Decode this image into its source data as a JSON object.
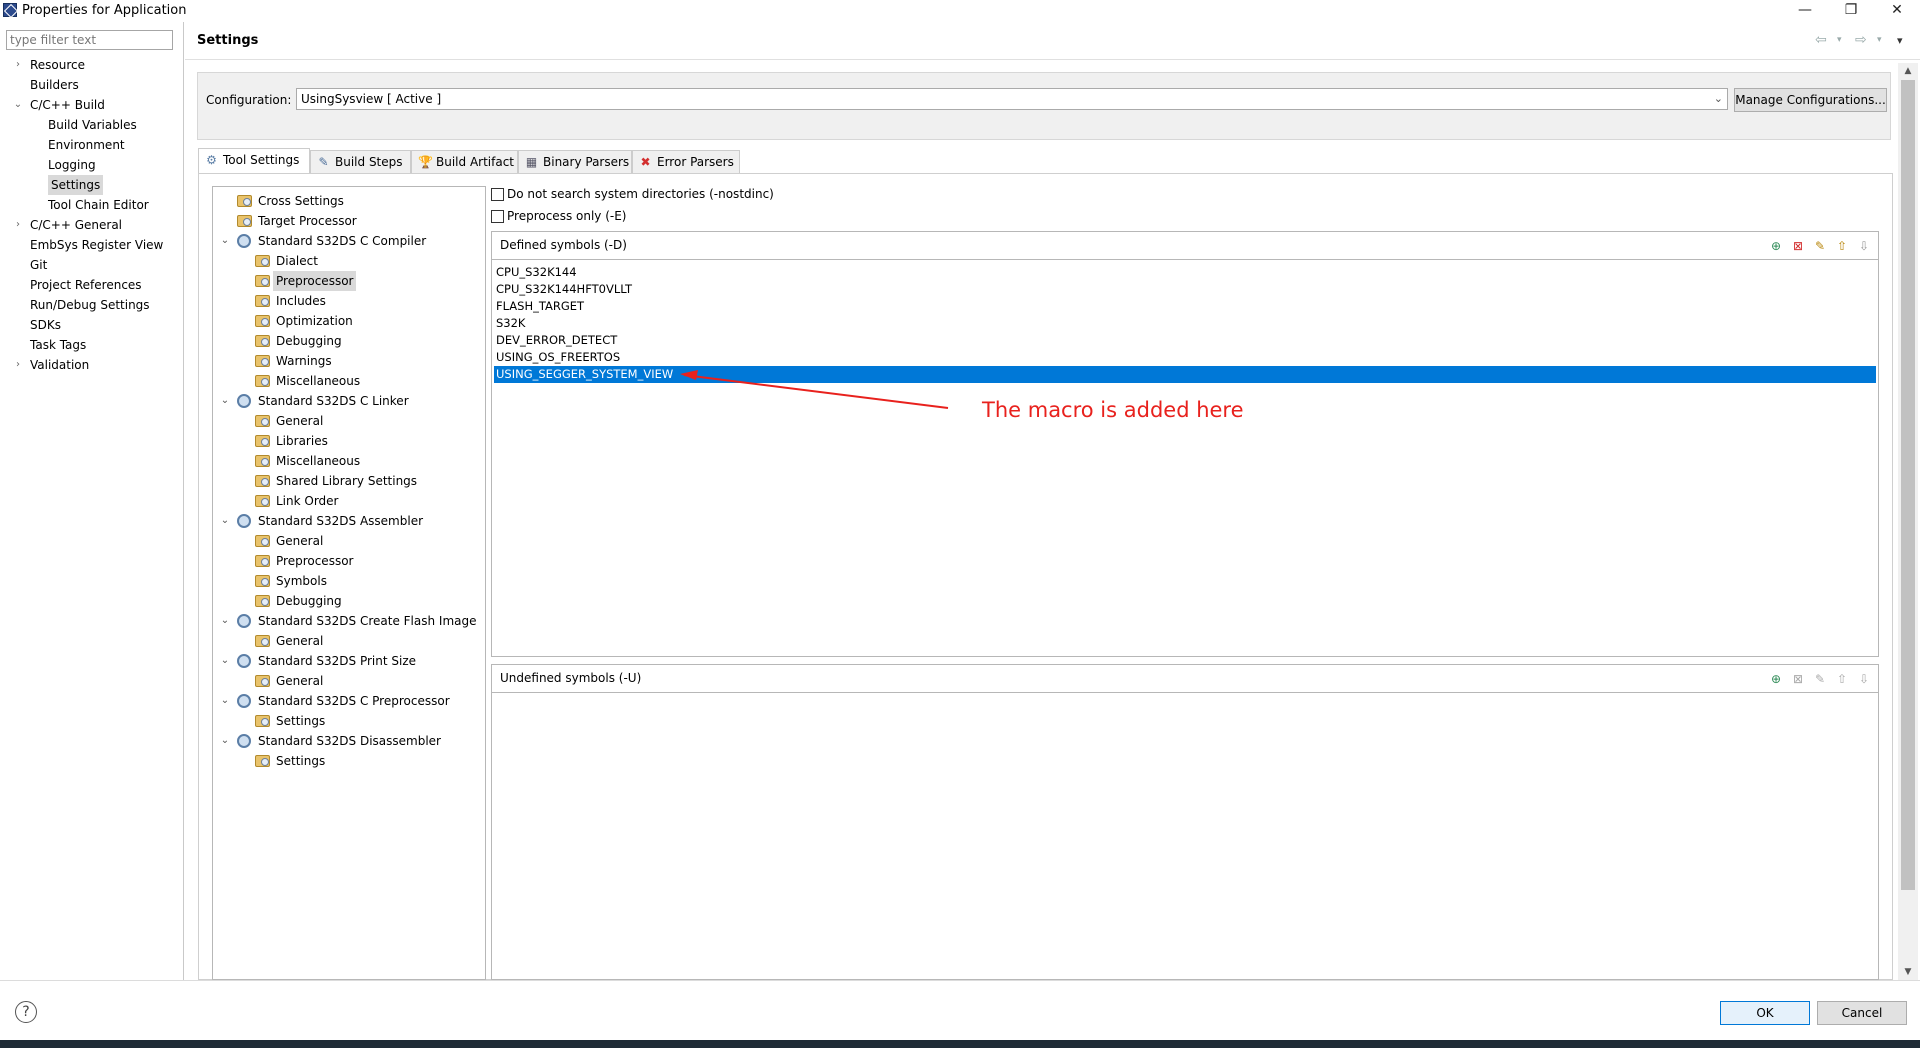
{
  "window": {
    "title": "Properties for Application",
    "minimize": "—",
    "restore": "❐",
    "close": "✕"
  },
  "left": {
    "filter_placeholder": "type filter text",
    "items": [
      {
        "label": "Resource",
        "caret": "›"
      },
      {
        "label": "Builders",
        "caret": ""
      },
      {
        "label": "C/C++ Build",
        "caret": "⌄"
      },
      {
        "label": "Build Variables",
        "caret": ""
      },
      {
        "label": "Environment",
        "caret": ""
      },
      {
        "label": "Logging",
        "caret": ""
      },
      {
        "label": "Settings",
        "caret": ""
      },
      {
        "label": "Tool Chain Editor",
        "caret": ""
      },
      {
        "label": "C/C++ General",
        "caret": "›"
      },
      {
        "label": "EmbSys Register View",
        "caret": ""
      },
      {
        "label": "Git",
        "caret": ""
      },
      {
        "label": "Project References",
        "caret": ""
      },
      {
        "label": "Run/Debug Settings",
        "caret": ""
      },
      {
        "label": "SDKs",
        "caret": ""
      },
      {
        "label": "Task Tags",
        "caret": ""
      },
      {
        "label": "Validation",
        "caret": "›"
      }
    ]
  },
  "header": {
    "title": "Settings",
    "back_icon": "⇦",
    "fwd_icon": "⇨",
    "menu_icon": "▾"
  },
  "config": {
    "label": "Configuration:",
    "value": "UsingSysview  [ Active ]",
    "arrow": "⌄",
    "manage_label": "Manage Configurations..."
  },
  "tabs": [
    {
      "label": "Tool Settings",
      "icon": "⚙"
    },
    {
      "label": "Build Steps",
      "icon": "✎"
    },
    {
      "label": "Build Artifact",
      "icon": "🏆"
    },
    {
      "label": "Binary Parsers",
      "icon": "▦"
    },
    {
      "label": "Error Parsers",
      "icon": "✖"
    }
  ],
  "tool_tree": [
    {
      "label": "Cross Settings",
      "caret": ""
    },
    {
      "label": "Target Processor",
      "caret": ""
    },
    {
      "label": "Standard S32DS C Compiler",
      "caret": "⌄"
    },
    {
      "label": "Dialect",
      "caret": ""
    },
    {
      "label": "Preprocessor",
      "caret": ""
    },
    {
      "label": "Includes",
      "caret": ""
    },
    {
      "label": "Optimization",
      "caret": ""
    },
    {
      "label": "Debugging",
      "caret": ""
    },
    {
      "label": "Warnings",
      "caret": ""
    },
    {
      "label": "Miscellaneous",
      "caret": ""
    },
    {
      "label": "Standard S32DS C Linker",
      "caret": "⌄"
    },
    {
      "label": "General",
      "caret": ""
    },
    {
      "label": "Libraries",
      "caret": ""
    },
    {
      "label": "Miscellaneous",
      "caret": ""
    },
    {
      "label": "Shared Library Settings",
      "caret": ""
    },
    {
      "label": "Link Order",
      "caret": ""
    },
    {
      "label": "Standard S32DS Assembler",
      "caret": "⌄"
    },
    {
      "label": "General",
      "caret": ""
    },
    {
      "label": "Preprocessor",
      "caret": ""
    },
    {
      "label": "Symbols",
      "caret": ""
    },
    {
      "label": "Debugging",
      "caret": ""
    },
    {
      "label": "Standard S32DS Create Flash Image",
      "caret": "⌄"
    },
    {
      "label": "General",
      "caret": ""
    },
    {
      "label": "Standard S32DS Print Size",
      "caret": "⌄"
    },
    {
      "label": "General",
      "caret": ""
    },
    {
      "label": "Standard S32DS C Preprocessor",
      "caret": "⌄"
    },
    {
      "label": "Settings",
      "caret": ""
    },
    {
      "label": "Standard S32DS Disassembler",
      "caret": "⌄"
    },
    {
      "label": "Settings",
      "caret": ""
    }
  ],
  "options": {
    "nostdinc_label": "Do not search system directories (-nostdinc)",
    "preprocess_only_label": "Preprocess only (-E)"
  },
  "defined": {
    "title": "Defined symbols (-D)",
    "symbols": [
      "CPU_S32K144",
      "CPU_S32K144HFT0VLLT",
      "FLASH_TARGET",
      "S32K",
      "DEV_ERROR_DETECT",
      "USING_OS_FREERTOS",
      "USING_SEGGER_SYSTEM_VIEW"
    ]
  },
  "undefined": {
    "title": "Undefined symbols (-U)"
  },
  "list_tools": [
    "add-icon",
    "delete-icon",
    "edit-icon",
    "move-up-icon",
    "move-down-icon"
  ],
  "annotation": {
    "text": "The macro is added here",
    "color": "#e8211d"
  },
  "buttons": {
    "ok": "OK",
    "cancel": "Cancel",
    "help": "?"
  },
  "colors": {
    "selection": "#0078d7"
  }
}
